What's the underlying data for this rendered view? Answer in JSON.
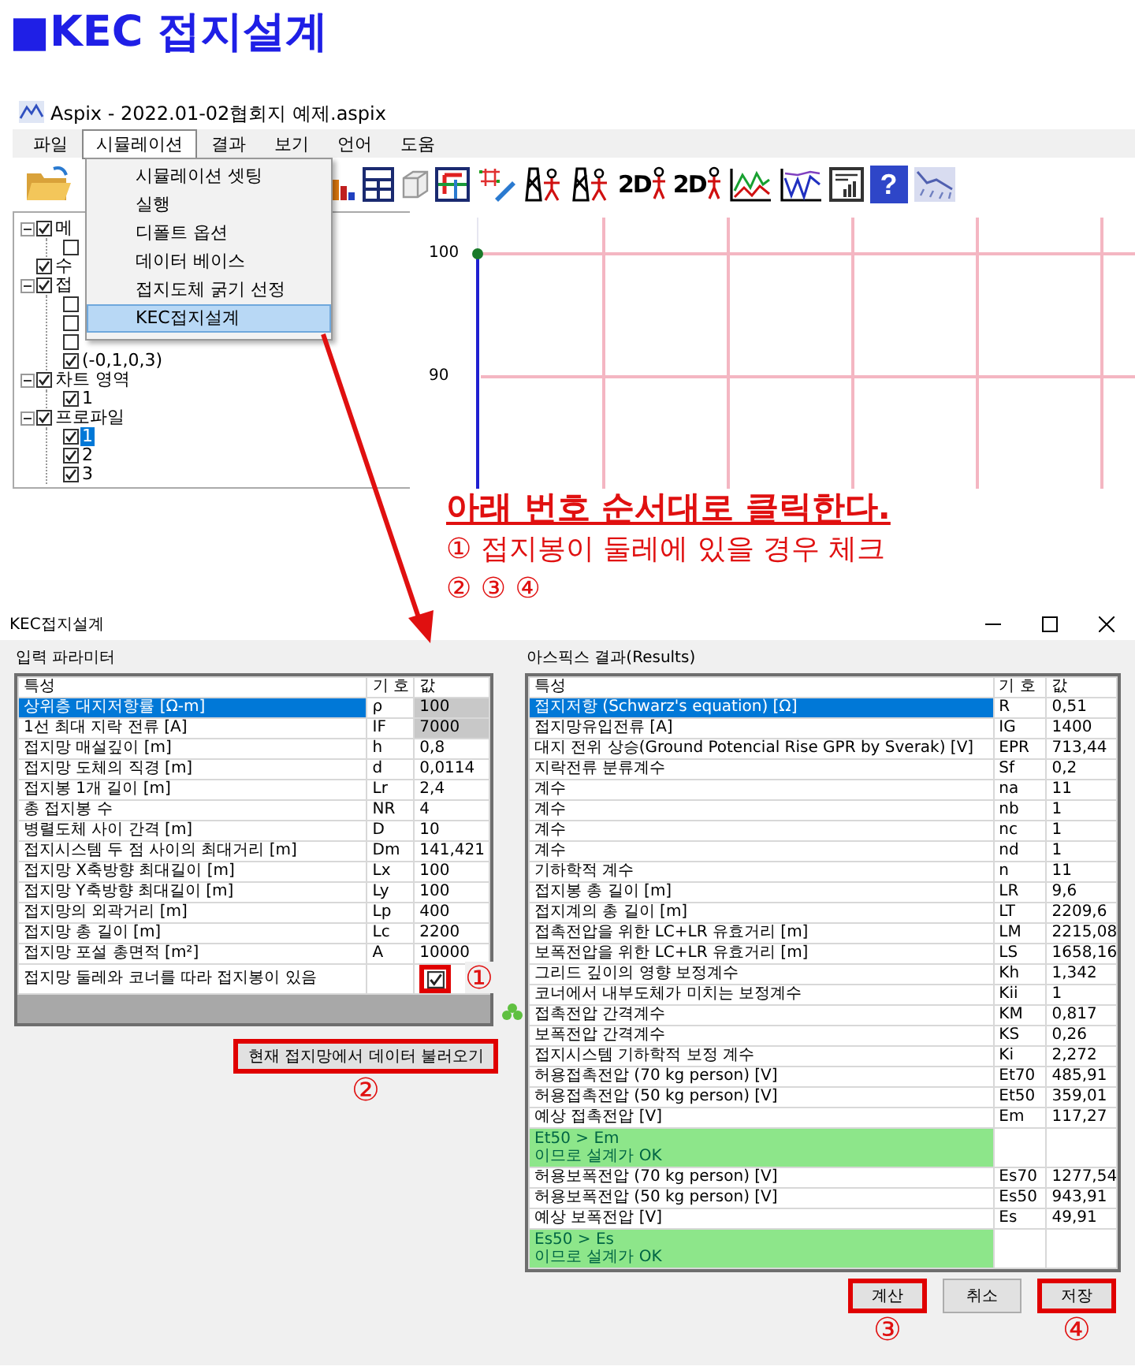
{
  "heading": "■KEC 접지설계",
  "app": {
    "title": "Aspix - 2022.01-02협회지 예제.aspix",
    "menu": [
      {
        "label": "파일",
        "selected": false
      },
      {
        "label": "시뮬레이션",
        "selected": true
      },
      {
        "label": "결과",
        "selected": false
      },
      {
        "label": "보기",
        "selected": false
      },
      {
        "label": "언어",
        "selected": false
      },
      {
        "label": "도움",
        "selected": false
      }
    ],
    "dropdown": [
      {
        "label": "시뮬레이션 셋팅",
        "selected": false
      },
      {
        "label": "실행",
        "selected": false
      },
      {
        "label": "디폴트 옵션",
        "selected": false
      },
      {
        "label": "데이터 베이스",
        "selected": false
      },
      {
        "label": "접지도체 굵기 선정",
        "selected": false
      },
      {
        "label": "KEC접지설계",
        "selected": true
      }
    ],
    "toolbar": [
      {
        "kind": "folder"
      },
      {
        "kind": "bars"
      },
      {
        "kind": "table"
      },
      {
        "kind": "cube"
      },
      {
        "kind": "gridcolor"
      },
      {
        "kind": "gridpencil"
      },
      {
        "kind": "tower"
      },
      {
        "kind": "tower"
      },
      {
        "kind": "twod",
        "label": "2D"
      },
      {
        "kind": "twod",
        "label": "2D"
      },
      {
        "kind": "peaks"
      },
      {
        "kind": "waves"
      },
      {
        "kind": "report"
      },
      {
        "kind": "help",
        "label": "?"
      },
      {
        "kind": "terrain"
      }
    ],
    "tree": [
      {
        "label": "메",
        "checked": true,
        "expanded": true,
        "selected": false,
        "children": [
          {
            "checked": false
          }
        ]
      },
      {
        "label": "수",
        "checked": true,
        "selected": false
      },
      {
        "label": "접",
        "checked": true,
        "expanded": true,
        "selected": false,
        "children": [
          {
            "checked": false
          },
          {
            "checked": false
          },
          {
            "checked": false
          },
          {
            "label": "(-0,1,0,3)",
            "checked": true,
            "selected": false
          }
        ]
      },
      {
        "label": "차트 영역",
        "checked": true,
        "expanded": true,
        "selected": false,
        "children": [
          {
            "label": "1",
            "checked": true,
            "selected": false
          }
        ]
      },
      {
        "label": "프로파일",
        "checked": true,
        "expanded": true,
        "selected": false,
        "children": [
          {
            "label": "1",
            "checked": true,
            "selected": true
          },
          {
            "label": "2",
            "checked": true,
            "selected": false
          },
          {
            "label": "3",
            "checked": true,
            "selected": false
          }
        ]
      }
    ],
    "chart_axis_labels": [
      "100",
      "90"
    ]
  },
  "instructions": {
    "title": "아래 번호 순서대로 클릭한다.",
    "lines": [
      "① 접지봉이 둘레에 있을 경우 체크",
      "② ③ ④"
    ]
  },
  "dialog": {
    "title": "KEC접지설계",
    "input": {
      "title": "입력 파라미터",
      "columns": [
        "특성",
        "기 호",
        "값"
      ],
      "rows": [
        {
          "kind": "value",
          "name": "상위층 대지저항률 [Ω-m]",
          "symbol": "ρ",
          "value": "100",
          "selected": true,
          "shaded": true
        },
        {
          "kind": "value",
          "name": "1선 최대 지락 전류 [A]",
          "symbol": "IF",
          "value": "7000",
          "selected": false,
          "shaded": true
        },
        {
          "kind": "value",
          "name": "접지망 매설깊이 [m]",
          "symbol": "h",
          "value": "0,8",
          "selected": false,
          "shaded": false
        },
        {
          "kind": "value",
          "name": "접지망 도체의 직경 [m]",
          "symbol": "d",
          "value": "0,0114",
          "selected": false,
          "shaded": false
        },
        {
          "kind": "value",
          "name": "접지봉 1개 길이 [m]",
          "symbol": "Lr",
          "value": "2,4",
          "selected": false,
          "shaded": false
        },
        {
          "kind": "value",
          "name": "총 접지봉 수",
          "symbol": "NR",
          "value": "4",
          "selected": false,
          "shaded": false
        },
        {
          "kind": "value",
          "name": "병렬도체 사이 간격 [m]",
          "symbol": "D",
          "value": "10",
          "selected": false,
          "shaded": false
        },
        {
          "kind": "value",
          "name": "접지시스템 두 점 사이의 최대거리 [m]",
          "symbol": "Dm",
          "value": "141,421",
          "selected": false,
          "shaded": false
        },
        {
          "kind": "value",
          "name": "접지망 X축방향 최대길이 [m]",
          "symbol": "Lx",
          "value": "100",
          "selected": false,
          "shaded": false
        },
        {
          "kind": "value",
          "name": "접지망 Y축방향 최대길이 [m]",
          "symbol": "Ly",
          "value": "100",
          "selected": false,
          "shaded": false
        },
        {
          "kind": "value",
          "name": "접지망의 외곽거리 [m]",
          "symbol": "Lp",
          "value": "400",
          "selected": false,
          "shaded": false
        },
        {
          "kind": "value",
          "name": "접지망 총 길이 [m]",
          "symbol": "Lc",
          "value": "2200",
          "selected": false,
          "shaded": false
        },
        {
          "kind": "value",
          "name": "접지망 포설 총면적 [m²]",
          "symbol": "A",
          "value": "10000",
          "selected": false,
          "shaded": false
        },
        {
          "kind": "checkbox",
          "name": "접지망 둘레와 코너를 따라 접지봉이 있음",
          "checked": true,
          "selected": false,
          "highlighted": true,
          "callout": "①"
        }
      ],
      "load_button": {
        "label": "현재 접지망에서 데이터 불러오기",
        "highlighted": true,
        "callout": "②"
      }
    },
    "results": {
      "title": "아스픽스 결과(Results)",
      "columns": [
        "특성",
        "기 호",
        "값"
      ],
      "rows": [
        {
          "kind": "value",
          "name": "접지저항 (Schwarz's equation) [Ω]",
          "symbol": "R",
          "value": "0,51",
          "selected": true
        },
        {
          "kind": "value",
          "name": "접지망유입전류 [A]",
          "symbol": "IG",
          "value": "1400",
          "selected": false
        },
        {
          "kind": "value",
          "name": "대지 전위 상승(Ground Potencial Rise GPR by Sverak) [V]",
          "symbol": "EPR",
          "value": "713,44",
          "selected": false
        },
        {
          "kind": "value",
          "name": "지락전류 분류계수",
          "symbol": "Sf",
          "value": "0,2",
          "selected": false
        },
        {
          "kind": "value",
          "name": "계수",
          "symbol": "na",
          "value": "11",
          "selected": false
        },
        {
          "kind": "value",
          "name": "계수",
          "symbol": "nb",
          "value": "1",
          "selected": false
        },
        {
          "kind": "value",
          "name": "계수",
          "symbol": "nc",
          "value": "1",
          "selected": false
        },
        {
          "kind": "value",
          "name": "계수",
          "symbol": "nd",
          "value": "1",
          "selected": false
        },
        {
          "kind": "value",
          "name": "기하학적 계수",
          "symbol": "n",
          "value": "11",
          "selected": false
        },
        {
          "kind": "value",
          "name": "접지봉 총 길이 [m]",
          "symbol": "LR",
          "value": "9,6",
          "selected": false
        },
        {
          "kind": "value",
          "name": "접지계의 총 길이 [m]",
          "symbol": "LT",
          "value": "2209,6",
          "selected": false
        },
        {
          "kind": "value",
          "name": "접촉전압을 위한 LC+LR 유효거리 [m]",
          "symbol": "LM",
          "value": "2215,08",
          "selected": false
        },
        {
          "kind": "value",
          "name": "보폭전압을 위한 LC+LR 유효거리 [m]",
          "symbol": "LS",
          "value": "1658,16",
          "selected": false
        },
        {
          "kind": "value",
          "name": "그리드 깊이의 영향 보정계수",
          "symbol": "Kh",
          "value": "1,342",
          "selected": false
        },
        {
          "kind": "value",
          "name": "코너에서 내부도체가 미치는 보정계수",
          "symbol": "Kii",
          "value": "1",
          "selected": false
        },
        {
          "kind": "value",
          "name": "접촉전압 간격계수",
          "symbol": "KM",
          "value": "0,817",
          "selected": false
        },
        {
          "kind": "value",
          "name": "보폭전압 간격계수",
          "symbol": "KS",
          "value": "0,26",
          "selected": false
        },
        {
          "kind": "value",
          "name": "접지시스템 기하학적 보정 계수",
          "symbol": "Ki",
          "value": "2,272",
          "selected": false
        },
        {
          "kind": "value",
          "name": "허용접촉전압 (70 kg person) [V]",
          "symbol": "Et70",
          "value": "485,91",
          "selected": false
        },
        {
          "kind": "value",
          "name": "허용접촉전압 (50 kg person) [V]",
          "symbol": "Et50",
          "value": "359,01",
          "selected": false
        },
        {
          "kind": "value",
          "name": "예상 접촉전압 [V]",
          "symbol": "Em",
          "value": "117,27",
          "selected": false
        },
        {
          "kind": "verdict",
          "name": "Et50 > Em\n이므로 설계가 OK"
        },
        {
          "kind": "value",
          "name": "허용보폭전압 (70 kg person) [V]",
          "symbol": "Es70",
          "value": "1277,54",
          "selected": false
        },
        {
          "kind": "value",
          "name": "허용보폭전압 (50 kg person) [V]",
          "symbol": "Es50",
          "value": "943,91",
          "selected": false
        },
        {
          "kind": "value",
          "name": "예상 보폭전압 [V]",
          "symbol": "Es",
          "value": "49,91",
          "selected": false
        },
        {
          "kind": "verdict",
          "name": "Es50 > Es\n이므로 설계가 OK"
        }
      ]
    },
    "buttons": [
      {
        "label": "계산",
        "highlighted": true,
        "callout": "③"
      },
      {
        "label": "취소",
        "highlighted": false
      },
      {
        "label": "저장",
        "highlighted": true,
        "callout": "④"
      }
    ]
  }
}
